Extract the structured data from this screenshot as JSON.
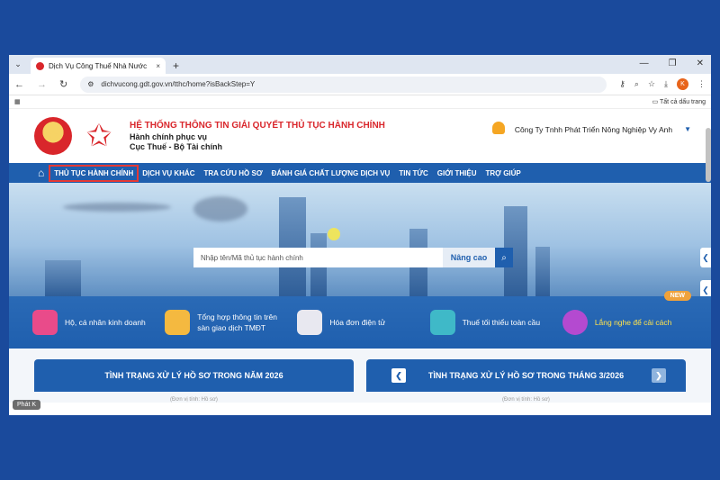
{
  "browser": {
    "tab_title": "Dịch Vụ Công Thuế Nhà Nước",
    "tab_close": "×",
    "new_tab": "+",
    "url": "dichvucong.gdt.gov.vn/tthc/home?isBackStep=Y",
    "profile_letter": "K",
    "bookmarks_label": "Tất cả dấu trang"
  },
  "header": {
    "system_title": "HỆ THỐNG THÔNG TIN GIẢI QUYẾT THỦ TỤC HÀNH CHÍNH",
    "subtitle1": "Hành chính phục vụ",
    "subtitle2": "Cục Thuế - Bộ Tài chính",
    "company": "Công Ty Tnhh Phát Triển Nông Nghiệp Vy Anh"
  },
  "nav": {
    "items": [
      "THỦ TỤC HÀNH CHÍNH",
      "DỊCH VỤ KHÁC",
      "TRA CỨU HỒ SƠ",
      "ĐÁNH GIÁ CHẤT LƯỢNG DỊCH VỤ",
      "TIN TỨC",
      "GIỚI THIỆU",
      "TRỢ GIÚP"
    ],
    "active_index": 0
  },
  "search": {
    "placeholder": "Nhập tên/Mã thủ tục hành chính",
    "advanced_label": "Nâng cao"
  },
  "services": [
    {
      "label": "Hộ, cá nhân kinh doanh",
      "icon": "household-business-icon",
      "color": "#e94b8a"
    },
    {
      "label": "Tổng hợp thông tin trên sàn giao dịch TMĐT",
      "icon": "ecommerce-report-icon",
      "color": "#f4b940"
    },
    {
      "label": "Hóa đơn điện tử",
      "icon": "e-invoice-icon",
      "color": "#e8e8f0"
    },
    {
      "label": "Thuế tối thiểu toàn cầu",
      "icon": "global-tax-icon",
      "color": "#3fb9c8"
    },
    {
      "label": "Lắng nghe để cải cách",
      "icon": "listen-feedback-icon",
      "color": "#b44ad0"
    }
  ],
  "new_badge": "NEW",
  "cards": {
    "left_title": "TÌNH TRẠNG XỬ LÝ HỒ SƠ TRONG NĂM 2026",
    "right_title": "TÌNH TRẠNG XỬ LÝ HỒ SƠ TRONG THÁNG 3/2026",
    "unit_note": "(Đơn vị tính: Hồ sơ)"
  },
  "overlay_label": "Phát K"
}
